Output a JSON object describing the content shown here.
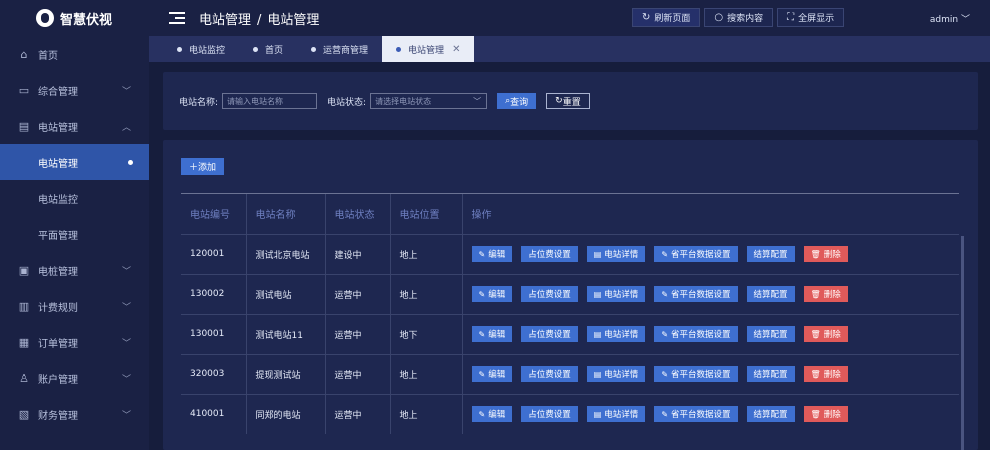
{
  "app": {
    "logo_text": "智慧伏视"
  },
  "header": {
    "breadcrumb": [
      "电站管理",
      "电站管理"
    ],
    "sep": "/",
    "buttons": {
      "refresh": "刷新页面",
      "search": "搜索内容",
      "fullscreen": "全屏显示"
    },
    "user": "admin"
  },
  "sidebar": {
    "items": [
      {
        "label": "首页",
        "icon": "home-icon"
      },
      {
        "label": "综合管理",
        "icon": "monitor-icon"
      },
      {
        "label": "电站管理",
        "icon": "building-icon"
      },
      {
        "label": "电站管理",
        "icon": ""
      },
      {
        "label": "电站监控",
        "icon": ""
      },
      {
        "label": "平面管理",
        "icon": ""
      },
      {
        "label": "电桩管理",
        "icon": "charger-icon"
      },
      {
        "label": "计费规则",
        "icon": "book-icon"
      },
      {
        "label": "订单管理",
        "icon": "order-icon"
      },
      {
        "label": "账户管理",
        "icon": "user-icon"
      },
      {
        "label": "财务管理",
        "icon": "finance-icon"
      }
    ]
  },
  "tabs": [
    "电站监控",
    "首页",
    "运营商管理",
    "电站管理"
  ],
  "filters": {
    "name_label": "电站名称:",
    "name_placeholder": "请输入电站名称",
    "status_label": "电站状态:",
    "status_placeholder": "请选择电站状态",
    "query": "查询",
    "reset": "重置"
  },
  "toolbar": {
    "add": "添加"
  },
  "table": {
    "headers": [
      "电站编号",
      "电站名称",
      "电站状态",
      "电站位置",
      "操作"
    ],
    "rows": [
      [
        "120001",
        "测试北京电站",
        "建设中",
        "地上"
      ],
      [
        "130002",
        "测试电站",
        "运营中",
        "地上"
      ],
      [
        "130001",
        "测试电站11",
        "运营中",
        "地下"
      ],
      [
        "320003",
        "提现测试站",
        "运营中",
        "地上"
      ],
      [
        "410001",
        "同郑的电站",
        "运营中",
        "地上"
      ]
    ],
    "actions": [
      "编辑",
      "占位费设置",
      "电站详情",
      "省平台数据设置",
      "结算配置",
      "删除"
    ]
  }
}
